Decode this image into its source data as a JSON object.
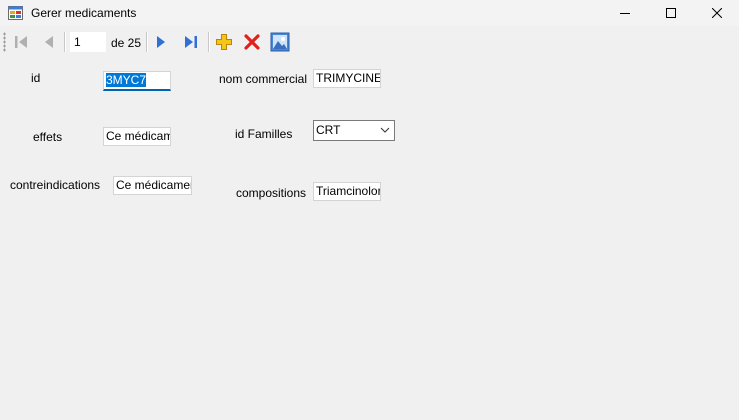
{
  "window": {
    "title": "Gerer medicaments"
  },
  "navigator": {
    "position": "1",
    "count_label": "de 25"
  },
  "form": {
    "id_label": "id",
    "id_value": "3MYC7",
    "effets_label": "effets",
    "effets_value": "Ce médicame",
    "contre_label": "contreindications",
    "contre_value": "Ce médicament",
    "nom_label": "nom commercial",
    "nom_value": "TRIMYCINE",
    "famille_label": "id Familles",
    "famille_value": "CRT",
    "compo_label": "compositions",
    "compo_value": "Triamcinolone"
  },
  "icons": {
    "move_first": "move-first-icon",
    "move_previous": "move-previous-icon",
    "move_next": "move-next-icon",
    "move_last": "move-last-icon",
    "add_new": "add-icon",
    "delete": "delete-icon",
    "image": "image-icon"
  },
  "colors": {
    "accent": "#0078d7",
    "nav_blue": "#2f6fd6",
    "add_yellow": "#f5c518",
    "delete_red": "#e0201b"
  }
}
